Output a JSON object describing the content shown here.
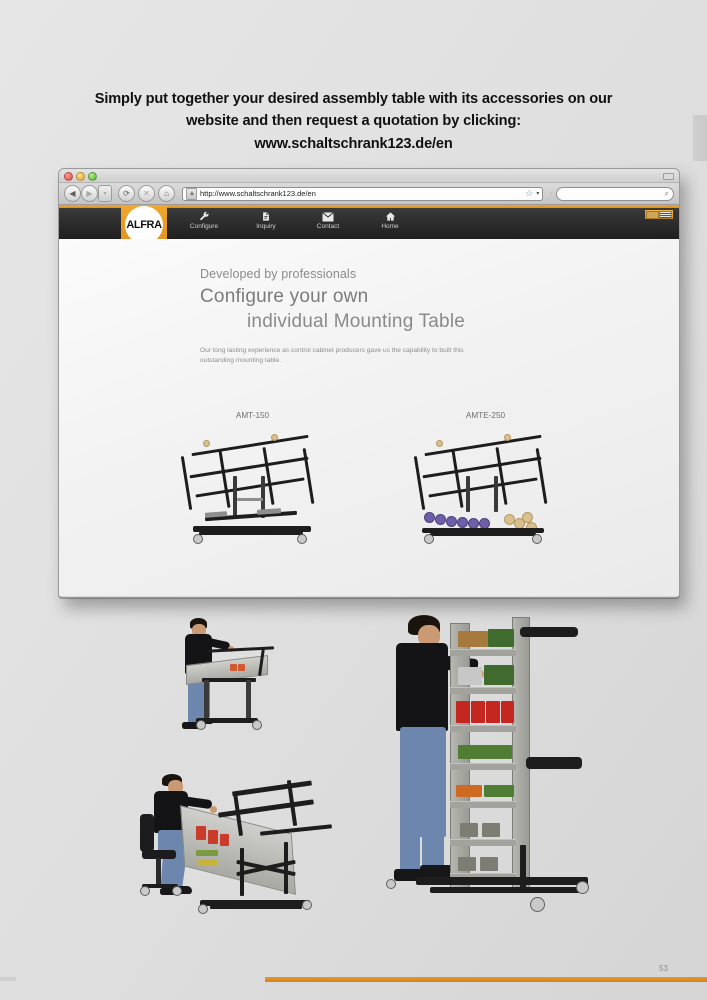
{
  "page": {
    "heading_lines": [
      "Simply put together your desired assembly table with its accessories on our",
      "website and then request a quotation by clicking:",
      "www.schaltschrank123.de/en"
    ],
    "page_number": "53",
    "accent_color": "#e08f20",
    "background_color": "#e2e2e2"
  },
  "browser": {
    "traffic_lights": [
      "close-red",
      "minimize-yellow",
      "zoom-green"
    ],
    "toolbar": {
      "back_label": "◀",
      "forward_label": "▶",
      "dropdown_label": "▾",
      "reload_label": "⟳",
      "stop_label": "✕",
      "home_label": "⌂",
      "url": "http://www.schaltschrank123.de/en",
      "bookmark_label": "☆",
      "bookmark_chevron": "▾",
      "separator_label": "·",
      "search_placeholder": "",
      "search_icon_label": "⌕"
    }
  },
  "site": {
    "logo_text": "ALFRA",
    "nav": [
      {
        "label": "Configure",
        "icon": "wrench-icon"
      },
      {
        "label": "Inquiry",
        "icon": "document-icon"
      },
      {
        "label": "Contact",
        "icon": "envelope-icon"
      },
      {
        "label": "Home",
        "icon": "house-icon"
      }
    ],
    "language_selector": "flag-switcher",
    "hero": {
      "eyebrow": "Developed by professionals",
      "title_line1": "Configure your own",
      "title_line2": "individual Mounting Table",
      "body": "Our long lasting experience as control cabinet producers gave us the capability to built this outstanding mounting table."
    },
    "products": [
      {
        "label": "AMT-150"
      },
      {
        "label": "AMTE-250"
      }
    ]
  },
  "photos": [
    {
      "name": "standing-operator-at-assembly-table"
    },
    {
      "name": "seated-operator-at-tilted-assembly-table"
    },
    {
      "name": "operator-at-vertical-mounting-rack"
    }
  ]
}
